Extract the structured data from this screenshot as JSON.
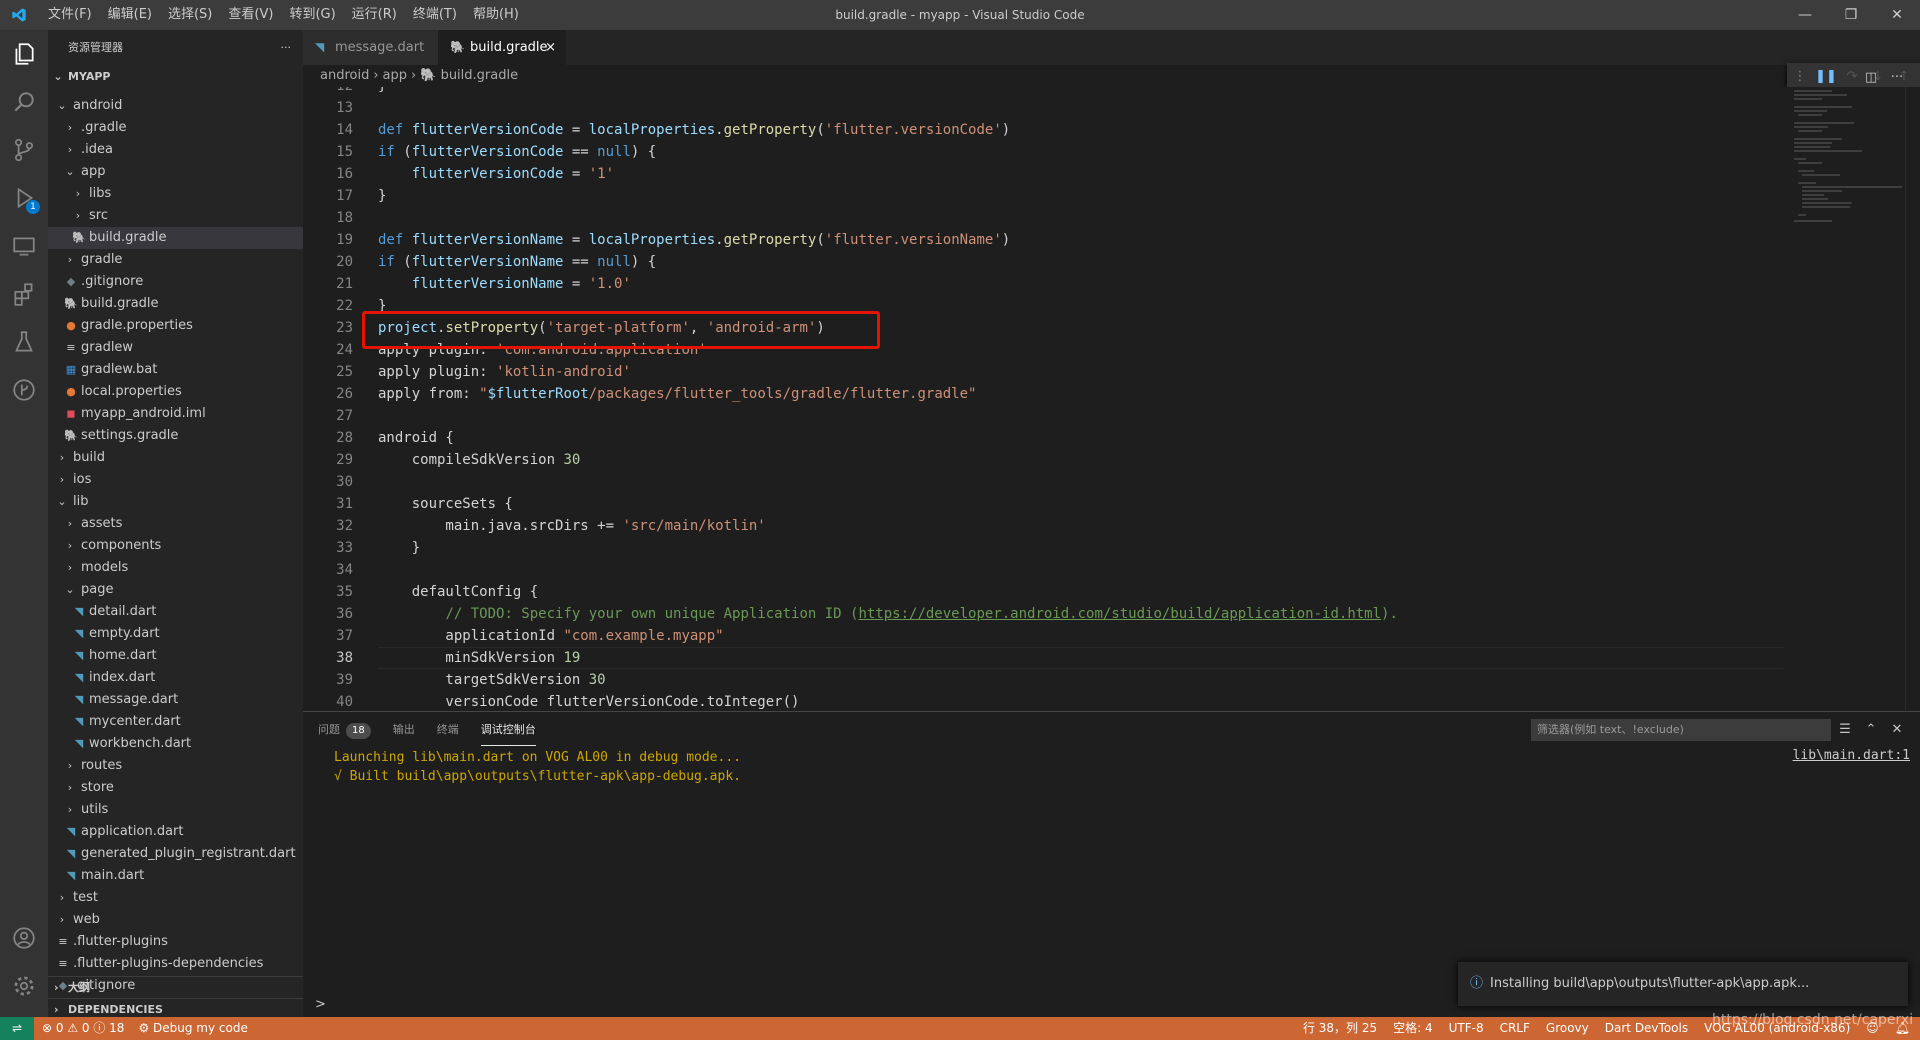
{
  "titlebar": {
    "menus": [
      "文件(F)",
      "编辑(E)",
      "选择(S)",
      "查看(V)",
      "转到(G)",
      "运行(R)",
      "终端(T)",
      "帮助(H)"
    ],
    "title": "build.gradle - myapp - Visual Studio Code"
  },
  "activity": {
    "run_badge": "1"
  },
  "sidebar": {
    "title": "资源管理器",
    "root": "MYAPP",
    "tree": [
      {
        "label": "android",
        "kind": "folder-open",
        "depth": 1
      },
      {
        "label": ".gradle",
        "kind": "folder",
        "depth": 2
      },
      {
        "label": ".idea",
        "kind": "folder",
        "depth": 2
      },
      {
        "label": "app",
        "kind": "folder-open",
        "depth": 2
      },
      {
        "label": "libs",
        "kind": "folder",
        "depth": 3
      },
      {
        "label": "src",
        "kind": "folder",
        "depth": 3
      },
      {
        "label": "build.gradle",
        "kind": "gradle",
        "depth": 3,
        "active": true
      },
      {
        "label": "gradle",
        "kind": "folder",
        "depth": 2
      },
      {
        "label": ".gitignore",
        "kind": "gitignore",
        "depth": 2
      },
      {
        "label": "build.gradle",
        "kind": "gradle",
        "depth": 2
      },
      {
        "label": "gradle.properties",
        "kind": "properties",
        "depth": 2
      },
      {
        "label": "gradlew",
        "kind": "text",
        "depth": 2
      },
      {
        "label": "gradlew.bat",
        "kind": "bat",
        "depth": 2
      },
      {
        "label": "local.properties",
        "kind": "properties",
        "depth": 2
      },
      {
        "label": "myapp_android.iml",
        "kind": "iml",
        "depth": 2
      },
      {
        "label": "settings.gradle",
        "kind": "gradle",
        "depth": 2
      },
      {
        "label": "build",
        "kind": "folder",
        "depth": 1
      },
      {
        "label": "ios",
        "kind": "folder",
        "depth": 1
      },
      {
        "label": "lib",
        "kind": "folder-open",
        "depth": 1
      },
      {
        "label": "assets",
        "kind": "folder",
        "depth": 2
      },
      {
        "label": "components",
        "kind": "folder",
        "depth": 2
      },
      {
        "label": "models",
        "kind": "folder",
        "depth": 2
      },
      {
        "label": "page",
        "kind": "folder-open",
        "depth": 2
      },
      {
        "label": "detail.dart",
        "kind": "dart",
        "depth": 3
      },
      {
        "label": "empty.dart",
        "kind": "dart",
        "depth": 3
      },
      {
        "label": "home.dart",
        "kind": "dart",
        "depth": 3
      },
      {
        "label": "index.dart",
        "kind": "dart",
        "depth": 3
      },
      {
        "label": "message.dart",
        "kind": "dart",
        "depth": 3
      },
      {
        "label": "mycenter.dart",
        "kind": "dart",
        "depth": 3
      },
      {
        "label": "workbench.dart",
        "kind": "dart",
        "depth": 3
      },
      {
        "label": "routes",
        "kind": "folder",
        "depth": 2
      },
      {
        "label": "store",
        "kind": "folder",
        "depth": 2
      },
      {
        "label": "utils",
        "kind": "folder",
        "depth": 2
      },
      {
        "label": "application.dart",
        "kind": "dart",
        "depth": 2
      },
      {
        "label": "generated_plugin_registrant.dart",
        "kind": "dart",
        "depth": 2
      },
      {
        "label": "main.dart",
        "kind": "dart",
        "depth": 2
      },
      {
        "label": "test",
        "kind": "folder",
        "depth": 1
      },
      {
        "label": "web",
        "kind": "folder",
        "depth": 1
      },
      {
        "label": ".flutter-plugins",
        "kind": "text",
        "depth": 1
      },
      {
        "label": ".flutter-plugins-dependencies",
        "kind": "text",
        "depth": 1
      },
      {
        "label": ".gitignore",
        "kind": "gitignore",
        "depth": 1
      }
    ],
    "outline": "大纲",
    "dependencies": "DEPENDENCIES"
  },
  "tabs": [
    {
      "label": "message.dart",
      "active": false
    },
    {
      "label": "build.gradle",
      "active": true,
      "close": "×"
    }
  ],
  "breadcrumb": [
    "android",
    "app",
    "build.gradle"
  ],
  "editor": {
    "current_line": 38,
    "lines": [
      {
        "n": 12,
        "t": [
          [
            "pl",
            "}"
          ]
        ]
      },
      {
        "n": 13,
        "t": []
      },
      {
        "n": 14,
        "t": [
          [
            "kw",
            "def "
          ],
          [
            "id",
            "flutterVersionCode"
          ],
          [
            "pl",
            " = "
          ],
          [
            "id",
            "localProperties"
          ],
          [
            "pl",
            "."
          ],
          [
            "fn",
            "getProperty"
          ],
          [
            "pl",
            "("
          ],
          [
            "str",
            "'flutter.versionCode'"
          ],
          [
            "pl",
            ")"
          ]
        ]
      },
      {
        "n": 15,
        "t": [
          [
            "kw",
            "if"
          ],
          [
            "pl",
            " ("
          ],
          [
            "id",
            "flutterVersionCode"
          ],
          [
            "pl",
            " == "
          ],
          [
            "kw",
            "null"
          ],
          [
            "pl",
            ") {"
          ]
        ]
      },
      {
        "n": 16,
        "t": [
          [
            "pl",
            "    "
          ],
          [
            "id",
            "flutterVersionCode"
          ],
          [
            "pl",
            " = "
          ],
          [
            "str",
            "'1'"
          ]
        ]
      },
      {
        "n": 17,
        "t": [
          [
            "pl",
            "}"
          ]
        ]
      },
      {
        "n": 18,
        "t": []
      },
      {
        "n": 19,
        "t": [
          [
            "kw",
            "def "
          ],
          [
            "id",
            "flutterVersionName"
          ],
          [
            "pl",
            " = "
          ],
          [
            "id",
            "localProperties"
          ],
          [
            "pl",
            "."
          ],
          [
            "fn",
            "getProperty"
          ],
          [
            "pl",
            "("
          ],
          [
            "str",
            "'flutter.versionName'"
          ],
          [
            "pl",
            ")"
          ]
        ]
      },
      {
        "n": 20,
        "t": [
          [
            "kw",
            "if"
          ],
          [
            "pl",
            " ("
          ],
          [
            "id",
            "flutterVersionName"
          ],
          [
            "pl",
            " == "
          ],
          [
            "kw",
            "null"
          ],
          [
            "pl",
            ") {"
          ]
        ]
      },
      {
        "n": 21,
        "t": [
          [
            "pl",
            "    "
          ],
          [
            "id",
            "flutterVersionName"
          ],
          [
            "pl",
            " = "
          ],
          [
            "str",
            "'1.0'"
          ]
        ]
      },
      {
        "n": 22,
        "t": [
          [
            "pl",
            "}"
          ]
        ]
      },
      {
        "n": 23,
        "t": [
          [
            "id",
            "project"
          ],
          [
            "pl",
            "."
          ],
          [
            "fn",
            "setProperty"
          ],
          [
            "pl",
            "("
          ],
          [
            "str",
            "'target-platform'"
          ],
          [
            "pl",
            ", "
          ],
          [
            "str",
            "'android-arm'"
          ],
          [
            "pl",
            ")"
          ]
        ]
      },
      {
        "n": 24,
        "t": [
          [
            "pl",
            "apply plugin: "
          ],
          [
            "str",
            "'com.android.application'"
          ]
        ]
      },
      {
        "n": 25,
        "t": [
          [
            "pl",
            "apply plugin: "
          ],
          [
            "str",
            "'kotlin-android'"
          ]
        ]
      },
      {
        "n": 26,
        "t": [
          [
            "pl",
            "apply from: "
          ],
          [
            "str",
            "\""
          ],
          [
            "id",
            "$flutterRoot"
          ],
          [
            "str",
            "/packages/flutter_tools/gradle/flutter.gradle\""
          ]
        ]
      },
      {
        "n": 27,
        "t": []
      },
      {
        "n": 28,
        "t": [
          [
            "pl",
            "android {"
          ]
        ]
      },
      {
        "n": 29,
        "t": [
          [
            "pl",
            "    compileSdkVersion "
          ],
          [
            "num",
            "30"
          ]
        ]
      },
      {
        "n": 30,
        "t": []
      },
      {
        "n": 31,
        "t": [
          [
            "pl",
            "    sourceSets {"
          ]
        ]
      },
      {
        "n": 32,
        "t": [
          [
            "pl",
            "        main.java.srcDirs += "
          ],
          [
            "str",
            "'src/main/kotlin'"
          ]
        ]
      },
      {
        "n": 33,
        "t": [
          [
            "pl",
            "    }"
          ]
        ]
      },
      {
        "n": 34,
        "t": []
      },
      {
        "n": 35,
        "t": [
          [
            "pl",
            "    defaultConfig {"
          ]
        ]
      },
      {
        "n": 36,
        "t": [
          [
            "pl",
            "        "
          ],
          [
            "cm",
            "// TODO: Specify your own unique Application ID ("
          ],
          [
            "url",
            "https://developer.android.com/studio/build/application-id.html"
          ],
          [
            "cm",
            ")."
          ]
        ]
      },
      {
        "n": 37,
        "t": [
          [
            "pl",
            "        applicationId "
          ],
          [
            "str",
            "\"com.example.myapp\""
          ]
        ]
      },
      {
        "n": 38,
        "t": [
          [
            "pl",
            "        minSdkVersion "
          ],
          [
            "num",
            "19"
          ]
        ]
      },
      {
        "n": 39,
        "t": [
          [
            "pl",
            "        targetSdkVersion "
          ],
          [
            "num",
            "30"
          ]
        ]
      },
      {
        "n": 40,
        "t": [
          [
            "pl",
            "        versionCode flutterVersionCode.toInteger()"
          ]
        ]
      }
    ]
  },
  "panel": {
    "tabs": [
      {
        "label": "问题",
        "badge": "18"
      },
      {
        "label": "输出"
      },
      {
        "label": "终端"
      },
      {
        "label": "调试控制台",
        "active": true
      }
    ],
    "filter_placeholder": "筛选器(例如 text、!exclude)",
    "output": [
      "Launching lib\\main.dart on VOG AL00 in debug mode...",
      "√ Built build\\app\\outputs\\flutter-apk\\app-debug.apk."
    ],
    "source_link": "lib\\main.dart:1",
    "prompt": ">"
  },
  "notification": {
    "text": "Installing build\\app\\outputs\\flutter-apk\\app.apk..."
  },
  "statusbar": {
    "problems": "⊗ 0 ⚠ 0 ⓘ 18",
    "debug": "Debug my code",
    "position": "行 38，列 25",
    "spaces": "空格: 4",
    "encoding": "UTF-8",
    "eol": "CRLF",
    "language": "Groovy",
    "devtools": "Dart DevTools",
    "device": "VOG AL00 (android-x86)"
  },
  "watermark": "https://blog.csdn.net/caperxi",
  "colors": {
    "statusbar": "#cc6633",
    "highlight_box": "#e51400",
    "accent": "#007acc"
  }
}
